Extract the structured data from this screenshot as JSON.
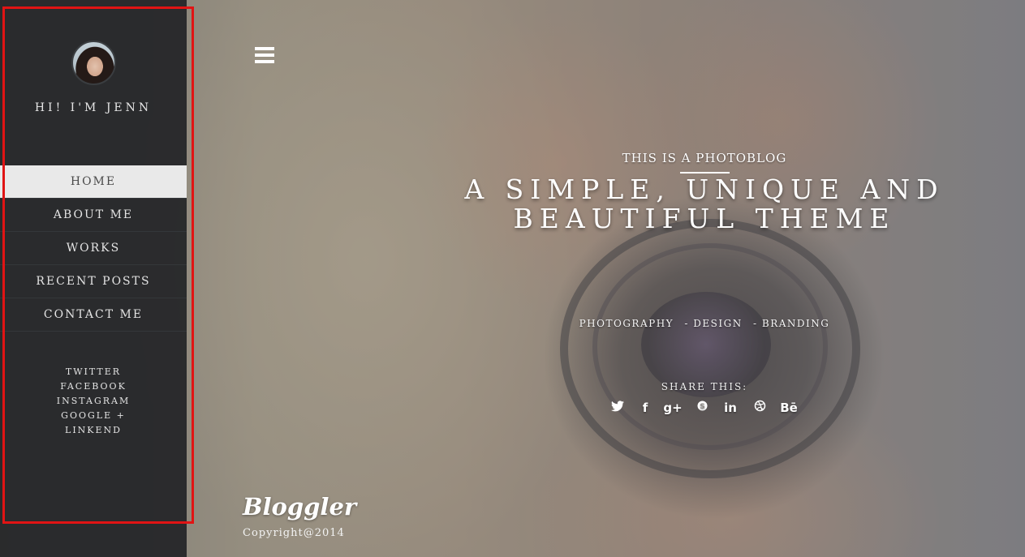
{
  "sidebar": {
    "greeting": "HI! I'M JENN",
    "nav": [
      {
        "label": "HOME",
        "active": true
      },
      {
        "label": "ABOUT ME",
        "active": false
      },
      {
        "label": "WORKS",
        "active": false
      },
      {
        "label": "RECENT POSTS",
        "active": false
      },
      {
        "label": "CONTACT ME",
        "active": false
      }
    ],
    "social": [
      "TWITTER",
      "FACEBOOK",
      "INSTAGRAM",
      "GOOGLE +",
      "LINKEND"
    ]
  },
  "hero": {
    "eyebrow": "THIS IS A PHOTOBLOG",
    "headline_line1": "A SIMPLE, UNIQUE AND",
    "headline_line2": "BEAUTIFUL THEME",
    "tags": [
      "PHOTOGRAPHY",
      "- DESIGN",
      "- BRANDING"
    ],
    "share_label": "SHARE THIS:",
    "share_icons": [
      {
        "name": "twitter-icon",
        "glyph": "🐦"
      },
      {
        "name": "facebook-icon",
        "glyph": "f"
      },
      {
        "name": "google-plus-icon",
        "glyph": "g+"
      },
      {
        "name": "skype-icon",
        "glyph": "S"
      },
      {
        "name": "linkedin-icon",
        "glyph": "in"
      },
      {
        "name": "dribbble-icon",
        "glyph": "◎"
      },
      {
        "name": "behance-icon",
        "glyph": "Bē"
      }
    ]
  },
  "footer": {
    "brand": "Bloggler",
    "copyright": "Copyright@2014"
  },
  "colors": {
    "sidebar_bg": "#26282a",
    "active_nav_bg": "#e9e9e9",
    "highlight_border": "#e11414",
    "text_light": "#ffffff"
  }
}
